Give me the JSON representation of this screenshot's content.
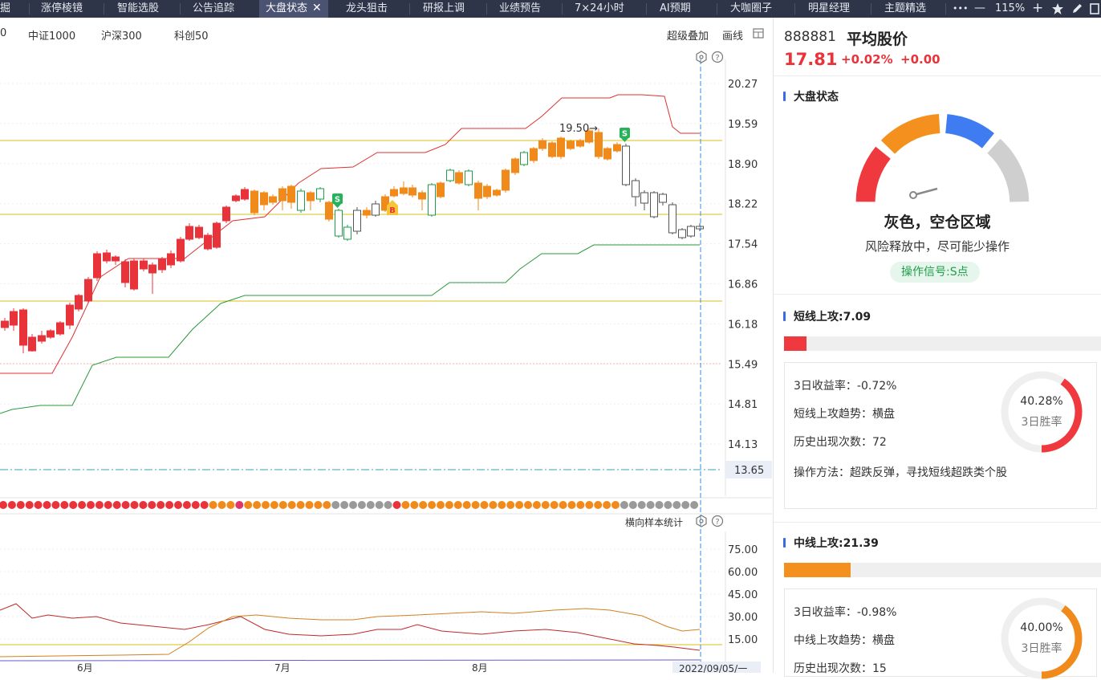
{
  "tabs": [
    {
      "label": "掘"
    },
    {
      "label": "涨停棱镜"
    },
    {
      "label": "智能选股"
    },
    {
      "label": "公告追踪"
    },
    {
      "label": "大盘状态",
      "active": true
    },
    {
      "label": "龙头狙击"
    },
    {
      "label": "研报上调"
    },
    {
      "label": "业绩预告"
    },
    {
      "label": "7×24小时"
    },
    {
      "label": "AI预期"
    },
    {
      "label": "大咖圈子"
    },
    {
      "label": "明星经理"
    },
    {
      "label": "主题精选"
    }
  ],
  "toolbar": {
    "more": "•••",
    "zoom_out": "—",
    "zoom": "115%",
    "zoom_in": "+",
    "close_x": "✕"
  },
  "indexbar": {
    "partial": "0",
    "items": [
      "中证1000",
      "沪深300",
      "科创50"
    ],
    "overlay": "超级叠加",
    "draw": "画线"
  },
  "chart": {
    "price_ticks": [
      "20.27",
      "19.59",
      "18.90",
      "18.22",
      "17.54",
      "16.86",
      "16.18",
      "15.49",
      "14.81",
      "14.13"
    ],
    "price_current": "13.65",
    "annotation": "19.50→",
    "signals": [
      {
        "label": "S"
      },
      {
        "label": "B"
      },
      {
        "label": "S"
      }
    ],
    "stat_label": "横向样本统计",
    "osc_ticks": [
      "75.00",
      "60.00",
      "45.00",
      "30.00",
      "15.00"
    ],
    "months": [
      "6月",
      "7月",
      "8月"
    ],
    "date_label": "2022/09/05/一",
    "colors": {
      "up": "#e8333b",
      "mid": "#f08a1a",
      "down": "#1e9e4a",
      "gray": "#9a9a9a"
    }
  },
  "panel": {
    "code": "888881",
    "name": "平均股价",
    "price": "17.81",
    "change_pct": "+0.02%",
    "change": "+0.00",
    "market_state": {
      "title": "大盘状态",
      "zone": "灰色，空仓区域",
      "desc": "风险释放中，尽可能少操作",
      "signal": "操作信号:S点"
    },
    "short": {
      "title": "短线上攻:7.09",
      "bar_fraction": 0.07,
      "ret": "3日收益率：-0.72%",
      "trend": "短线上攻趋势：横盘",
      "count": "历史出现次数：72",
      "method": "操作方法：超跌反弹，寻找短线超跌类个股",
      "win_rate": "40.28%",
      "win_rate_value": 0.4028,
      "win_label": "3日胜率",
      "color": "#f0393e"
    },
    "mid": {
      "title": "中线上攻:21.39",
      "bar_fraction": 0.21,
      "ret": "3日收益率：-0.98%",
      "trend": "中线上攻趋势：横盘",
      "count": "历史出现次数：15",
      "win_rate": "40.00%",
      "win_rate_value": 0.4,
      "win_label": "3日胜率",
      "color": "#f08a1a"
    }
  }
}
